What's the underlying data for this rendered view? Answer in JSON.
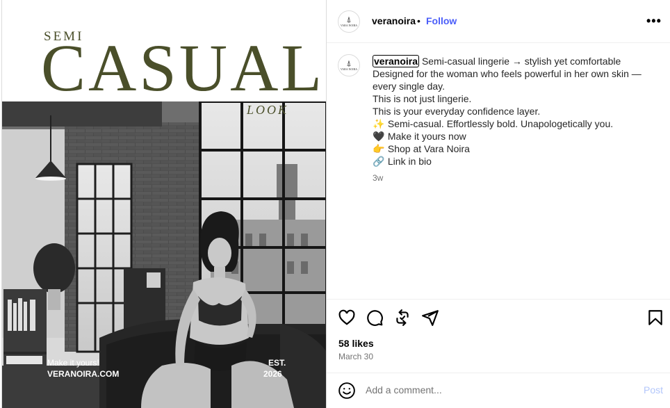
{
  "poster": {
    "headline_small": "SEMI",
    "headline_large": "CASUAL",
    "headline_sub": "LOOK",
    "tagline": "Make it yours!",
    "website": "VERANOIRA.COM",
    "est_label": "EST.",
    "est_year": "2026",
    "text_color": "#4a4f2a"
  },
  "account": {
    "username": "veranoira",
    "avatar_text": "VARA NOIRA"
  },
  "header": {
    "separator": "•",
    "follow_label": "Follow",
    "more_label": "•••"
  },
  "caption": {
    "username": "veranoira",
    "lines": [
      "Semi-casual lingerie → stylish yet comfortable",
      "Designed for the woman who feels powerful in her own skin — every single day.",
      "This is not just lingerie.",
      "This is your everyday confidence layer."
    ],
    "emoji_lines": [
      {
        "emoji": "✨",
        "text": "Semi-casual. Effortlessly bold. Unapologetically you."
      },
      {
        "emoji": "🖤",
        "text": "Make it yours now"
      },
      {
        "emoji": "👉",
        "text": "Shop at Vara Noira"
      },
      {
        "emoji": "🔗",
        "text": "Link in bio"
      }
    ],
    "time_ago": "3w"
  },
  "engagement": {
    "likes": "58 likes",
    "date": "March 30"
  },
  "actions": {
    "icons": [
      "heart-icon",
      "comment-icon",
      "repost-icon",
      "share-icon",
      "bookmark-icon"
    ]
  },
  "comment_box": {
    "placeholder": "Add a comment...",
    "post_label": "Post",
    "post_color": "#b3c7fb"
  },
  "colors": {
    "follow": "#4a5df9",
    "border": "#dbdbdb",
    "muted": "#737373"
  }
}
